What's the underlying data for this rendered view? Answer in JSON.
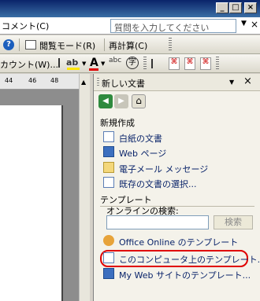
{
  "menu": {
    "comment": "コメント(C)",
    "help_placeholder": "質問を入力してください"
  },
  "toolbar1": {
    "reading_mode": "閲覧モード(R)",
    "recalc": "再計算(C)"
  },
  "toolbar2": {
    "account": "カウント(W)..."
  },
  "ruler": {
    "ticks": [
      "44",
      "46",
      "48"
    ]
  },
  "pane": {
    "title": "新しい文書",
    "new_section": "新規作成",
    "new_items": [
      {
        "label": "白紙の文書",
        "icon": "blank-doc-icon"
      },
      {
        "label": "Web ページ",
        "icon": "web-page-icon"
      },
      {
        "label": "電子メール メッセージ",
        "icon": "email-icon"
      },
      {
        "label": "既存の文書の選択...",
        "icon": "existing-doc-icon"
      }
    ],
    "template_section": "テンプレート",
    "online_search_label": "オンラインの検索:",
    "search_button": "検索",
    "template_items": [
      {
        "label": "Office Online のテンプレート",
        "icon": "office-online-icon"
      },
      {
        "label": "このコンピュータ上のテンプレート...",
        "icon": "computer-template-icon"
      },
      {
        "label": "My Web サイトのテンプレート...",
        "icon": "web-site-template-icon"
      }
    ]
  }
}
